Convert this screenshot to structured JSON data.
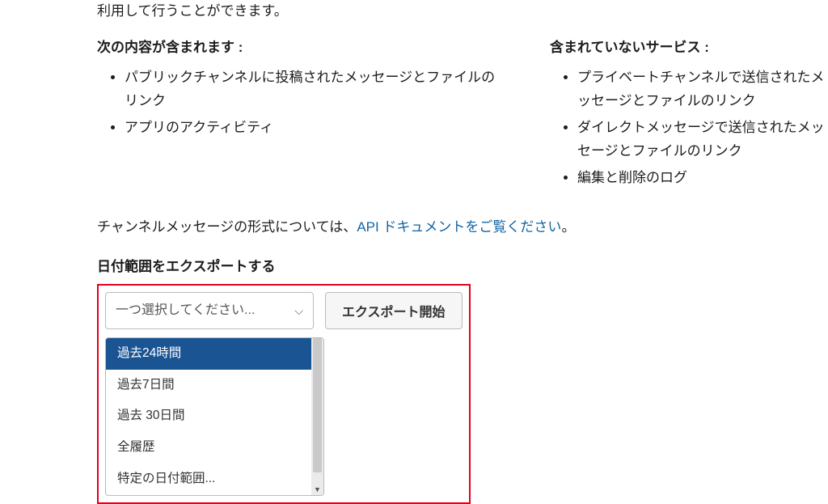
{
  "intro_text": "利用して行うことができます。",
  "included_title": "次の内容が含まれます :",
  "included_items": [
    "パブリックチャンネルに投稿されたメッセージとファイルのリンク",
    "アプリのアクティビティ"
  ],
  "excluded_title": "含まれていないサービス :",
  "excluded_items": [
    "プライベートチャンネルで送信されたメッセージとファイルのリンク",
    "ダイレクトメッセージで送信されたメッセージとファイルのリンク",
    "編集と削除のログ"
  ],
  "api_text_pre": "チャンネルメッセージの形式については、",
  "api_link": "API ドキュメントをご覧ください",
  "api_text_post": "。",
  "export_label": "日付範囲をエクスポートする",
  "select_placeholder": "一つ選択してください...",
  "export_button": "エクスポート開始",
  "dropdown_options": [
    "過去24時間",
    "過去7日間",
    "過去 30日間",
    "全履歴",
    "特定の日付範囲..."
  ]
}
